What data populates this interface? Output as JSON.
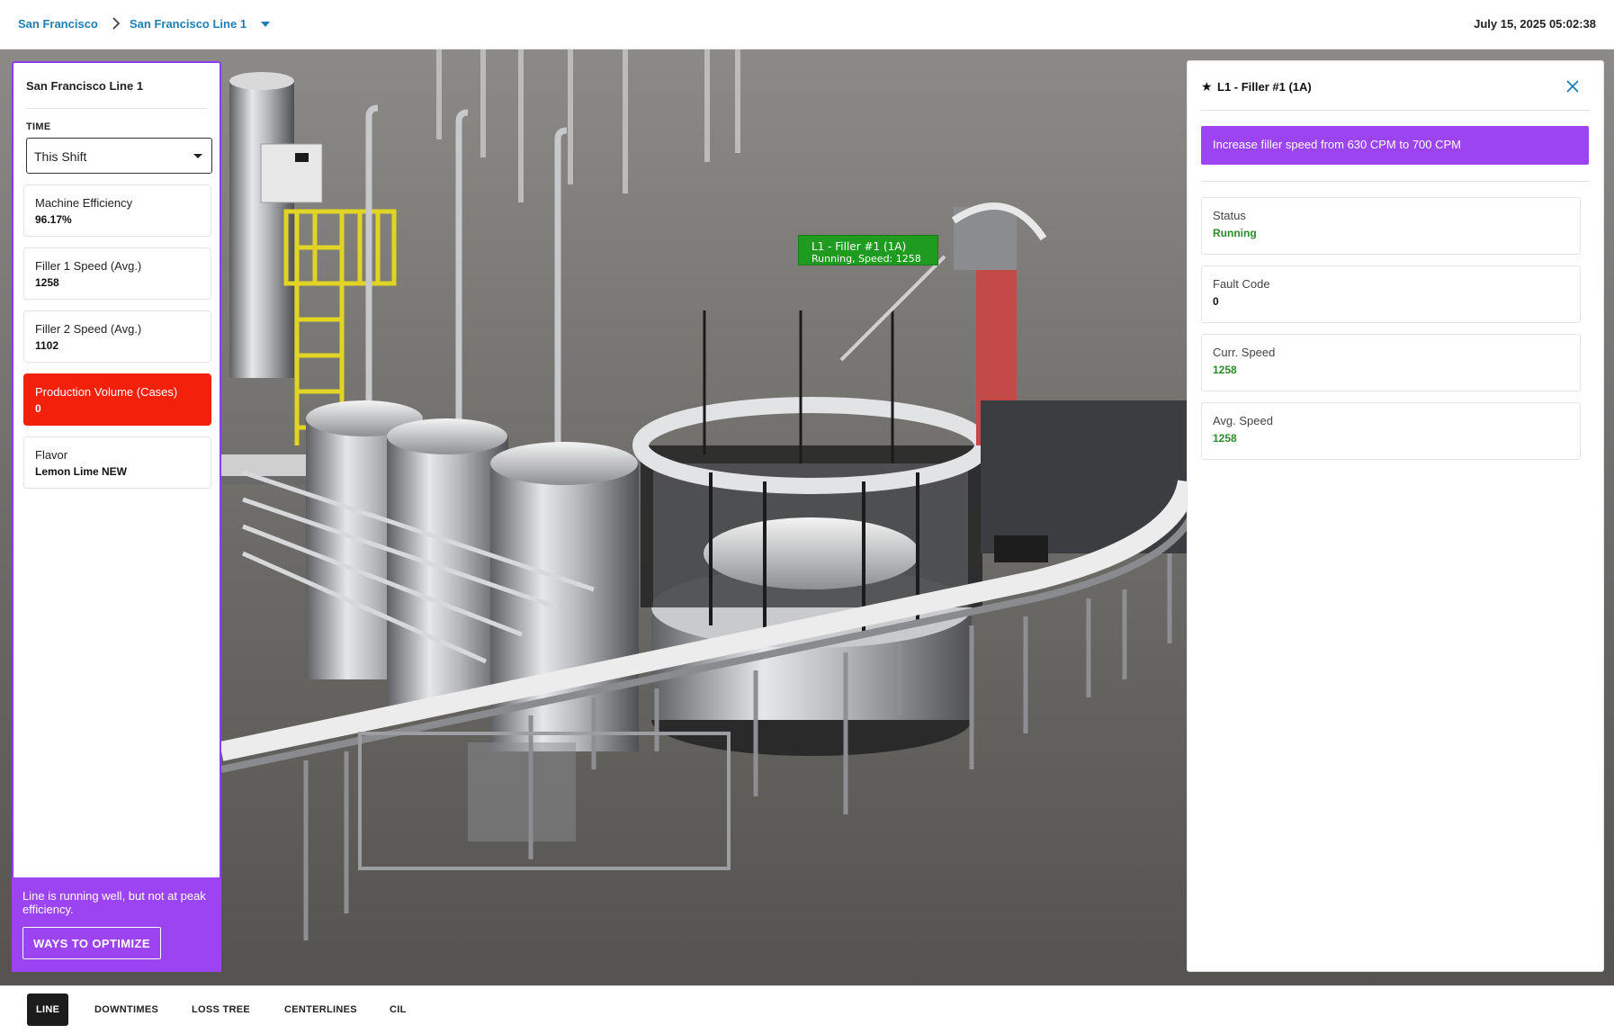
{
  "header": {
    "breadcrumb_site": "San Francisco",
    "breadcrumb_line": "San Francisco Line 1",
    "timestamp": "July 15, 2025 05:02:38"
  },
  "left_panel": {
    "title": "San Francisco Line 1",
    "time_label": "TIME",
    "time_select_value": "This Shift",
    "metrics": [
      {
        "label": "Machine Efficiency",
        "value": "96.17%",
        "alert": false
      },
      {
        "label": "Filler 1 Speed (Avg.)",
        "value": "1258",
        "alert": false
      },
      {
        "label": "Filler 2 Speed (Avg.)",
        "value": "1102",
        "alert": false
      },
      {
        "label": "Production Volume (Cases)",
        "value": "0",
        "alert": true
      },
      {
        "label": "Flavor",
        "value": "Lemon Lime NEW",
        "alert": false
      }
    ],
    "footer_message": "Line is running well, but not at peak efficiency.",
    "optimize_button": "WAYS TO OPTIMIZE"
  },
  "machine_tag": {
    "title": "L1 - Filler #1 (1A)",
    "subtitle": "Running, Speed: 1258"
  },
  "right_panel": {
    "title": "L1 - Filler #1 (1A)",
    "recommendation": "Increase filler speed from 630 CPM to 700 CPM",
    "cards": [
      {
        "label": "Status",
        "value": "Running",
        "green": true
      },
      {
        "label": "Fault Code",
        "value": "0",
        "green": false
      },
      {
        "label": "Curr. Speed",
        "value": "1258",
        "green": true
      },
      {
        "label": "Avg. Speed",
        "value": "1258",
        "green": true
      }
    ]
  },
  "tabs": [
    {
      "label": "LINE",
      "active": true
    },
    {
      "label": "DOWNTIMES",
      "active": false
    },
    {
      "label": "LOSS TREE",
      "active": false
    },
    {
      "label": "CENTERLINES",
      "active": false
    },
    {
      "label": "CIL",
      "active": false
    }
  ],
  "colors": {
    "accent_purple": "#9d44f2",
    "alert_red": "#f3200c",
    "running_green": "#2b8a2b",
    "link_blue": "#1d7fb3"
  }
}
